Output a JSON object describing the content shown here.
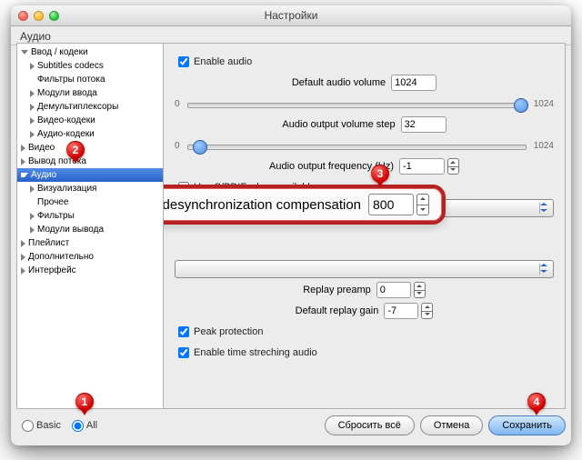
{
  "window": {
    "title": "Настройки"
  },
  "section": {
    "title": "Аудио"
  },
  "tree": {
    "n0": {
      "label": "Ввод / кодеки"
    },
    "n1": {
      "label": "Subtitles codecs"
    },
    "n2": {
      "label": "Фильтры потока"
    },
    "n3": {
      "label": "Модули ввода"
    },
    "n4": {
      "label": "Демультиплексоры"
    },
    "n5": {
      "label": "Видео-кодеки"
    },
    "n6": {
      "label": "Аудио-кодеки"
    },
    "n7": {
      "label": "Видео"
    },
    "n8": {
      "label": "Вывод потока"
    },
    "n9": {
      "label": "Аудио"
    },
    "n10": {
      "label": "Визуализация"
    },
    "n11": {
      "label": "Прочее"
    },
    "n12": {
      "label": "Фильтры"
    },
    "n13": {
      "label": "Модули вывода"
    },
    "n14": {
      "label": "Плейлист"
    },
    "n15": {
      "label": "Дополнительно"
    },
    "n16": {
      "label": "Интерфейс"
    }
  },
  "panel": {
    "enable_audio": "Enable audio",
    "default_volume_label": "Default audio volume",
    "default_volume_value": "1024",
    "slider1_min": "0",
    "slider1_max": "1024",
    "volume_step_label": "Audio output volume step",
    "volume_step_value": "32",
    "slider2_min": "0",
    "slider2_max": "1024",
    "freq_label": "Audio output frequency (Hz)",
    "freq_value": "-1",
    "spdif_label": "Use S/PDIF when available",
    "desync_label": "Audio desynchronization compensation",
    "desync_value": "800",
    "replay_preamp_label": "Replay preamp",
    "replay_preamp_value": "0",
    "default_replay_gain_label": "Default replay gain",
    "default_replay_gain_value": "-7",
    "peak_label": "Peak protection",
    "stretch_label": "Enable time streching audio"
  },
  "footer": {
    "basic": "Basic",
    "all": "All",
    "reset": "Сбросить всё",
    "cancel": "Отмена",
    "save": "Сохранить"
  },
  "markers": {
    "m1": "1",
    "m2": "2",
    "m3": "3",
    "m4": "4"
  }
}
